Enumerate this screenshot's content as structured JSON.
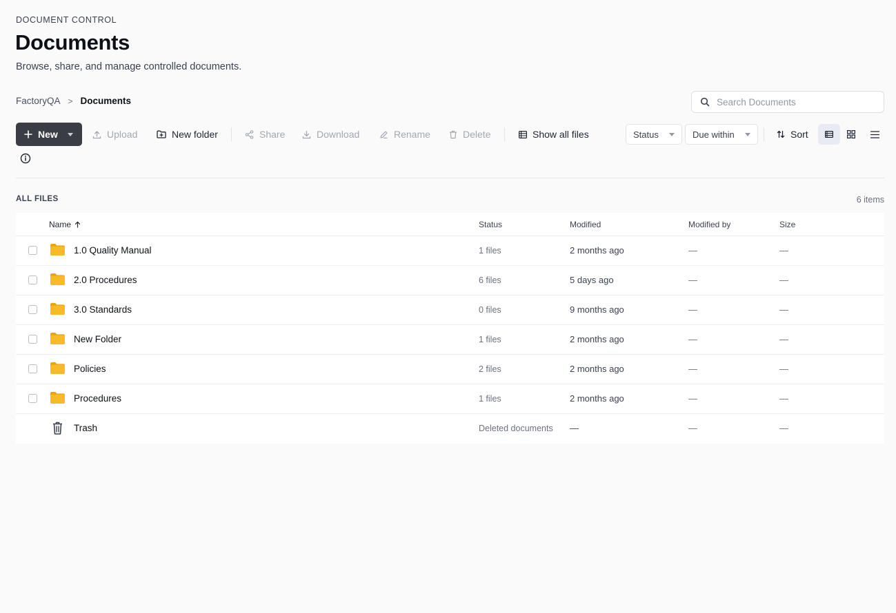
{
  "header": {
    "eyebrow": "DOCUMENT CONTROL",
    "title": "Documents",
    "subtitle": "Browse, share, and manage controlled documents."
  },
  "breadcrumb": {
    "root": "FactoryQA",
    "separator": ">",
    "current": "Documents"
  },
  "search": {
    "placeholder": "Search Documents",
    "value": ""
  },
  "toolbar": {
    "new_label": "New",
    "upload_label": "Upload",
    "new_folder_label": "New folder",
    "share_label": "Share",
    "download_label": "Download",
    "rename_label": "Rename",
    "delete_label": "Delete",
    "show_all_label": "Show all files",
    "status_filter": "Status",
    "due_filter": "Due within",
    "sort_label": "Sort",
    "active_view": "list"
  },
  "section": {
    "label": "ALL FILES",
    "count": "6 items"
  },
  "table": {
    "columns": {
      "name": "Name",
      "status": "Status",
      "modified": "Modified",
      "modified_by": "Modified by",
      "size": "Size"
    },
    "rows": [
      {
        "name": "1.0 Quality Manual",
        "status": "1 files",
        "modified": "2 months ago",
        "modified_by": "—",
        "size": "—"
      },
      {
        "name": "2.0 Procedures",
        "status": "6 files",
        "modified": "5 days ago",
        "modified_by": "—",
        "size": "—"
      },
      {
        "name": "3.0 Standards",
        "status": "0 files",
        "modified": "9 months ago",
        "modified_by": "—",
        "size": "—"
      },
      {
        "name": "New Folder",
        "status": "1 files",
        "modified": "2 months ago",
        "modified_by": "—",
        "size": "—"
      },
      {
        "name": "Policies",
        "status": "2 files",
        "modified": "2 months ago",
        "modified_by": "—",
        "size": "—"
      },
      {
        "name": "Procedures",
        "status": "1 files",
        "modified": "2 months ago",
        "modified_by": "—",
        "size": "—"
      },
      {
        "name": "Trash",
        "status": "Deleted documents",
        "modified": "—",
        "modified_by": "—",
        "size": "—"
      }
    ]
  },
  "colors": {
    "primary_button": "#3a3d44",
    "folder": "#f5b51e",
    "folder_dark": "#e9a310",
    "background": "#fafafa",
    "active_view_bg": "#e8ebf2"
  },
  "icons": {
    "search": "search-icon",
    "plus": "plus-icon",
    "upload": "upload-icon",
    "folder_plus": "folder-plus-icon",
    "share": "share-icon",
    "download": "download-icon",
    "rename": "pencil-icon",
    "delete": "trash-icon",
    "show_all": "list-table-icon",
    "sort": "sort-arrows-icon",
    "list_view": "list-view-icon",
    "grid_view": "grid-view-icon",
    "menu": "menu-lines-icon",
    "info": "info-icon",
    "folder": "folder-icon",
    "trash_row": "trash-bin-icon"
  }
}
